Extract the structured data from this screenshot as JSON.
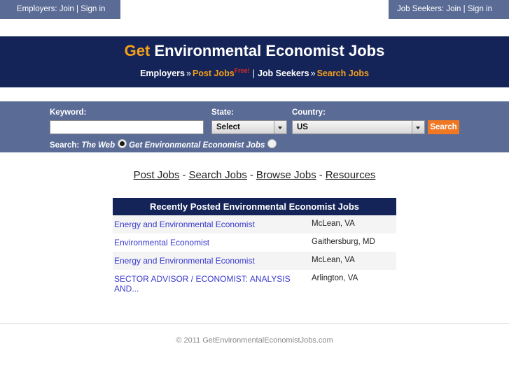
{
  "topbar": {
    "left_label": "Employers:",
    "left_join": "Join",
    "left_sep": "|",
    "left_signin": "Sign in",
    "right_label": "Job Seekers:",
    "right_join": "Join",
    "right_sep": "|",
    "right_signin": "Sign in"
  },
  "masthead": {
    "title_get": "Get",
    "title_rest": " Environmental Economist Jobs",
    "employers_label": "Employers",
    "arrow1": "»",
    "post_jobs": "Post Jobs",
    "free_badge": "Free!",
    "pipe": "|",
    "jobseekers_label": "Job Seekers",
    "arrow2": "»",
    "search_jobs": "Search Jobs",
    "bg_color": "#142458",
    "accent_color": "#f5a01a",
    "free_color": "#e8281e"
  },
  "search_form": {
    "keyword_label": "Keyword:",
    "keyword_value": "",
    "keyword_placeholder": "",
    "state_label": "State:",
    "state_value": "Select",
    "state_options": [
      "Select"
    ],
    "country_label": "Country:",
    "country_value": "US",
    "country_options": [
      "US"
    ],
    "search_button": "Search",
    "search_button_color": "#f07822",
    "band_color": "#5a6b96",
    "radio_prefix": "Search:",
    "radio_web_label": "The Web",
    "radio_site_label": "Get Environmental Economist Jobs",
    "radio_web_checked": true,
    "radio_site_checked": false
  },
  "mainnav": {
    "separator": "-",
    "items": [
      {
        "label": "Post Jobs"
      },
      {
        "label": "Search Jobs"
      },
      {
        "label": "Browse Jobs"
      },
      {
        "label": "Resources"
      }
    ]
  },
  "jobs_panel": {
    "header": "Recently Posted Environmental Economist Jobs",
    "header_color": "#142458",
    "rows": [
      {
        "title": "Energy and Environmental Economist",
        "location": "McLean, VA"
      },
      {
        "title": "Environmental Economist",
        "location": "Gaithersburg, MD"
      },
      {
        "title": "Energy and Environmental Economist",
        "location": "McLean, VA"
      },
      {
        "title": "SECTOR ADVISOR / ECONOMIST: ANALYSIS AND...",
        "location": "Arlington, VA"
      }
    ]
  },
  "footer": {
    "copyright": "© 2011 GetEnvironmentalEconomistJobs.com"
  }
}
